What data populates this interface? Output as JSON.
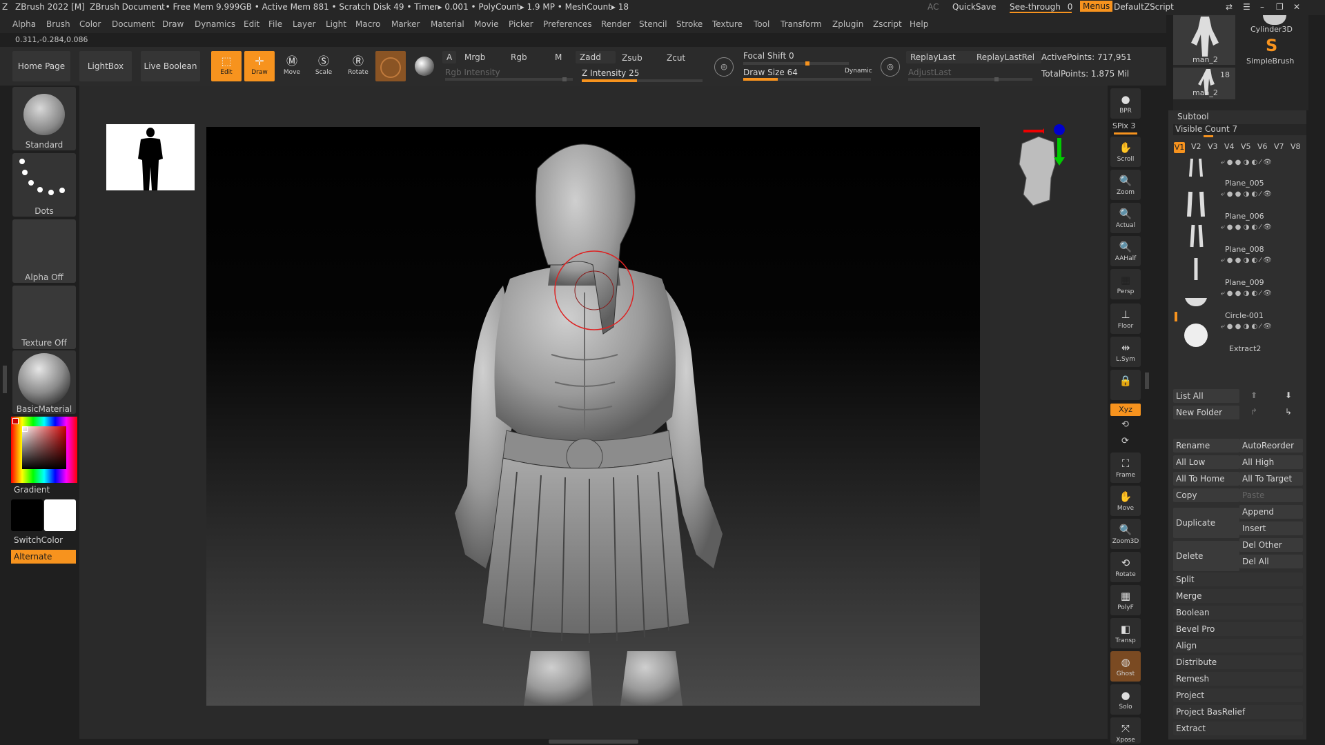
{
  "titlebar": {
    "app": "ZBrush 2022 [M]",
    "document": "ZBrush Document",
    "stats": ". • Free Mem 9.999GB • Active Mem 881 • Scratch Disk 49 • Timer▸ 0.001 • PolyCount▸ 1.9 MP • MeshCount▸ 18",
    "ac": "AC",
    "quicksave": "QuickSave",
    "seethrough_label": "See-through",
    "seethrough_value": "0",
    "menus": "Menus",
    "script": "DefaultZScript"
  },
  "menus": [
    "Alpha",
    "Brush",
    "Color",
    "Document",
    "Draw",
    "Dynamics",
    "Edit",
    "File",
    "Layer",
    "Light",
    "Macro",
    "Marker",
    "Material",
    "Movie",
    "Picker",
    "Preferences",
    "Render",
    "Stencil",
    "Stroke",
    "Texture",
    "Tool",
    "Transform",
    "Zplugin",
    "Zscript",
    "Help"
  ],
  "coords": "0.311,-0.284,0.086",
  "toolbar": {
    "home_page": "Home Page",
    "lightbox": "LightBox",
    "live_boolean": "Live Boolean",
    "tools": [
      {
        "label": "Edit",
        "active": true
      },
      {
        "label": "Draw",
        "active": true
      },
      {
        "label": "Move",
        "active": false
      },
      {
        "label": "Scale",
        "active": false
      },
      {
        "label": "Rotate",
        "active": false
      }
    ],
    "a_label": "A",
    "mrgb": "Mrgb",
    "rgb": "Rgb",
    "m": "M",
    "zadd": "Zadd",
    "zsub": "Zsub",
    "zcut": "Zcut",
    "rgb_intensity": "Rgb Intensity",
    "z_intensity_label": "Z Intensity",
    "z_intensity": "25",
    "focal_shift_label": "Focal Shift",
    "focal_shift": "0",
    "draw_size_label": "Draw Size",
    "draw_size": "64",
    "dynamic": "Dynamic",
    "replay_last": "ReplayLast",
    "replay_last_rel": "ReplayLastRel",
    "adjust_last": "AdjustLast",
    "active_points": "ActivePoints: 717,951",
    "total_points": "TotalPoints: 1.875 Mil"
  },
  "left_shelf": {
    "brush": "Standard",
    "stroke": "Dots",
    "alpha": "Alpha Off",
    "texture": "Texture Off",
    "material": "BasicMaterial",
    "gradient": "Gradient",
    "switch_color": "SwitchColor",
    "alternate": "Alternate"
  },
  "right_shelf": [
    {
      "label": "BPR"
    },
    {
      "label": "SPix 3"
    },
    {
      "label": "Scroll"
    },
    {
      "label": "Zoom"
    },
    {
      "label": "Actual"
    },
    {
      "label": "AAHalf"
    },
    {
      "label": "Persp"
    },
    {
      "label": "Floor"
    },
    {
      "label": "L.Sym"
    },
    {
      "label": "Xyz"
    },
    {
      "label": "Frame"
    },
    {
      "label": "Move"
    },
    {
      "label": "Zoom3D"
    },
    {
      "label": "Rotate"
    },
    {
      "label": "PolyF"
    },
    {
      "label": "Transp"
    },
    {
      "label": "Ghost"
    },
    {
      "label": "Solo"
    },
    {
      "label": "Xpose"
    }
  ],
  "tool_thumbs": {
    "a_label": "man_2",
    "b_label": "Cylinder3D",
    "c_label": "SimpleBrush",
    "d_label": "man_2",
    "d_count": "18"
  },
  "subtool": {
    "title": "Subtool",
    "visible_count": "Visible Count 7",
    "versions": [
      "V1",
      "V2",
      "V3",
      "V4",
      "V5",
      "V6",
      "V7",
      "V8"
    ],
    "items": [
      "Plane_005",
      "Plane_006",
      "Plane_008",
      "Plane_009",
      "Circle-001",
      "Extract2"
    ],
    "list_all": "List All",
    "new_folder": "New Folder",
    "buttons": {
      "rename": "Rename",
      "autoreorder": "AutoReorder",
      "all_low": "All Low",
      "all_high": "All High",
      "all_to_home": "All To Home",
      "all_to_target": "All To Target",
      "copy": "Copy",
      "paste": "Paste",
      "duplicate": "Duplicate",
      "append": "Append",
      "insert": "Insert",
      "delete": "Delete",
      "del_other": "Del Other",
      "del_all": "Del All"
    },
    "sections": [
      "Split",
      "Merge",
      "Boolean",
      "Bevel Pro",
      "Align",
      "Distribute",
      "Remesh",
      "Project",
      "Project BasRelief",
      "Extract"
    ]
  },
  "colors": {
    "accent": "#f7931e",
    "bg": "#1f1f1f",
    "panel": "#2f2f2f"
  }
}
